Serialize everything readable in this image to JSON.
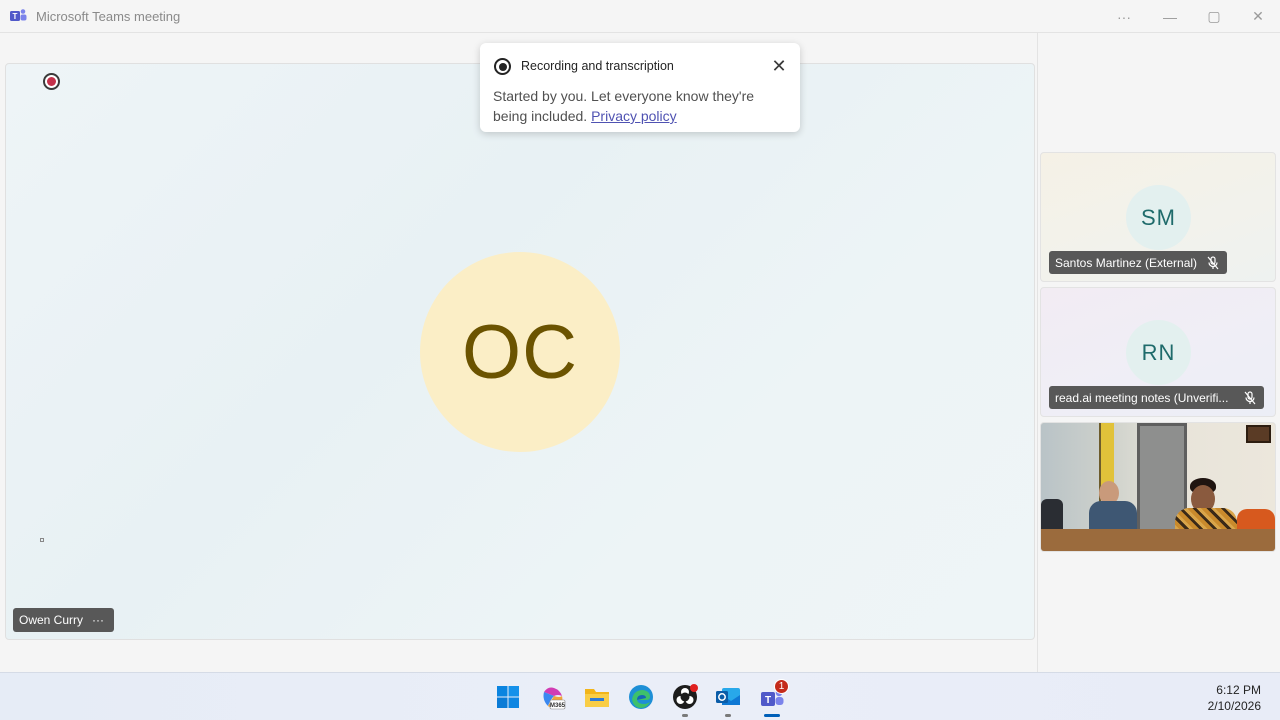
{
  "window": {
    "title": "Microsoft Teams meeting",
    "controls": {
      "more": "···",
      "minimize": "—",
      "maximize": "▢",
      "close": "✕"
    }
  },
  "main_tile": {
    "participant_initials": "OC",
    "participant_name": "Owen Curry",
    "more_label": "···",
    "recording_indicator": "record-icon"
  },
  "toast": {
    "title": "Recording and transcription",
    "body": "Started by you. Let everyone know they're being included.",
    "link": "Privacy policy",
    "close": "✕"
  },
  "participants": [
    {
      "initials": "SM",
      "name": "Santos Martinez (External)",
      "muted": true
    },
    {
      "initials": "RN",
      "name": "read.ai meeting notes (Unverifi...",
      "muted": true
    },
    {
      "video": true
    }
  ],
  "taskbar": {
    "apps": [
      "windows-start",
      "microsoft-365",
      "file-explorer",
      "edge",
      "obs",
      "outlook",
      "teams"
    ],
    "teams_badge": "1",
    "time": "6:12 PM",
    "date": "2/10/2026"
  },
  "colors": {
    "avatar_main_bg": "#fbeec6",
    "avatar_main_text": "#6b5300",
    "avatar_small_bg": "#e3f0ef",
    "avatar_small_text": "#1f6b6b",
    "link": "#4f52b2",
    "recording": "#c4314b"
  }
}
